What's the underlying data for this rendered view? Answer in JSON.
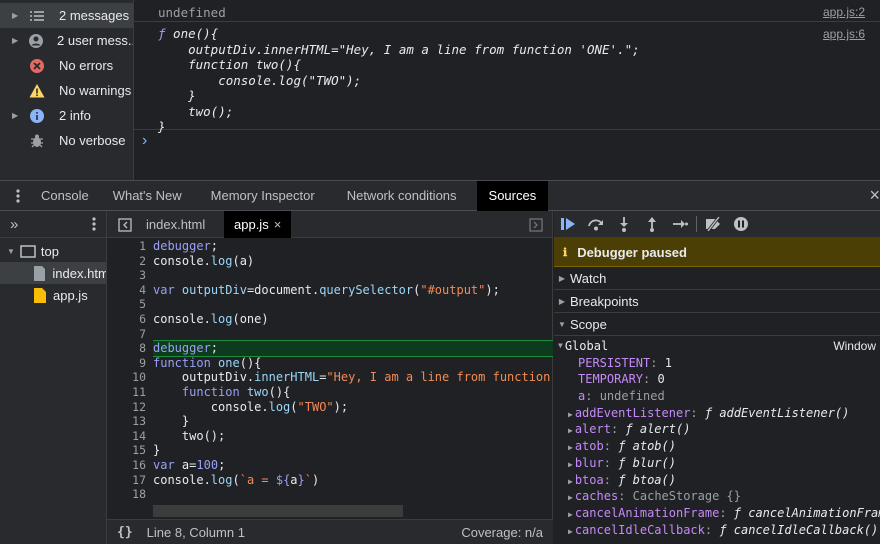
{
  "sidebar": {
    "items": [
      {
        "label": "2 messages",
        "icon": "list-icon",
        "expandable": true
      },
      {
        "label": "2 user mess...",
        "icon": "user-icon",
        "expandable": true
      },
      {
        "label": "No errors",
        "icon": "error-icon",
        "expandable": false
      },
      {
        "label": "No warnings",
        "icon": "warning-icon",
        "expandable": false
      },
      {
        "label": "2 info",
        "icon": "info-icon",
        "expandable": true
      },
      {
        "label": "No verbose",
        "icon": "bug-icon",
        "expandable": false
      }
    ]
  },
  "console": {
    "line1": {
      "text": "undefined",
      "source": "app.js:2"
    },
    "line2": {
      "source": "app.js:6",
      "code": [
        "ƒ one(){",
        "    outputDiv.innerHTML=\"Hey, I am a line from function 'ONE'.\";",
        "    function two(){",
        "        console.log(\"TWO\");",
        "    }",
        "    two();",
        "}"
      ]
    },
    "prompt": "›"
  },
  "tabs": [
    "Console",
    "What's New",
    "Memory Inspector",
    "Network conditions",
    "Sources"
  ],
  "active_tab": "Sources",
  "navigator": {
    "more": "»",
    "top": "top",
    "files": [
      "index.htm",
      "app.js"
    ]
  },
  "editor": {
    "tabs": [
      "index.html",
      "app.js"
    ],
    "close": "×",
    "line_numbers": [
      "1",
      "2",
      "3",
      "4",
      "5",
      "6",
      "7",
      "8",
      "9",
      "10",
      "11",
      "12",
      "13",
      "14",
      "15",
      "16",
      "17",
      "18"
    ],
    "status": {
      "braces": "{}",
      "position": "Line 8, Column 1",
      "coverage": "Coverage: n/a"
    }
  },
  "debugger": {
    "paused": "Debugger paused",
    "sections": [
      "Watch",
      "Breakpoints",
      "Scope"
    ],
    "global_label": "Global",
    "global_value": "Window",
    "scope": [
      {
        "name": "PERSISTENT",
        "sep": ": ",
        "value": "1",
        "expand": false
      },
      {
        "name": "TEMPORARY",
        "sep": ": ",
        "value": "0",
        "expand": false
      },
      {
        "name": "a",
        "sep": ": ",
        "value": "undefined",
        "expand": false
      },
      {
        "name": "addEventListener",
        "sep": ": ",
        "value": "ƒ addEventListener()",
        "expand": true
      },
      {
        "name": "alert",
        "sep": ": ",
        "value": "ƒ alert()",
        "expand": true
      },
      {
        "name": "atob",
        "sep": ": ",
        "value": "ƒ atob()",
        "expand": true
      },
      {
        "name": "blur",
        "sep": ": ",
        "value": "ƒ blur()",
        "expand": true
      },
      {
        "name": "btoa",
        "sep": ": ",
        "value": "ƒ btoa()",
        "expand": true
      },
      {
        "name": "caches",
        "sep": ": ",
        "value": "CacheStorage {}",
        "expand": true
      },
      {
        "name": "cancelAnimationFrame",
        "sep": ": ",
        "value": "ƒ cancelAnimationFram…",
        "expand": true
      },
      {
        "name": "cancelIdleCallback",
        "sep": ": ",
        "value": "ƒ cancelIdleCallback()",
        "expand": true
      }
    ]
  },
  "colors": {
    "accent": "#8ab4f8",
    "paused_bg": "#4b3f05",
    "highlight": "#0e3a1e"
  }
}
